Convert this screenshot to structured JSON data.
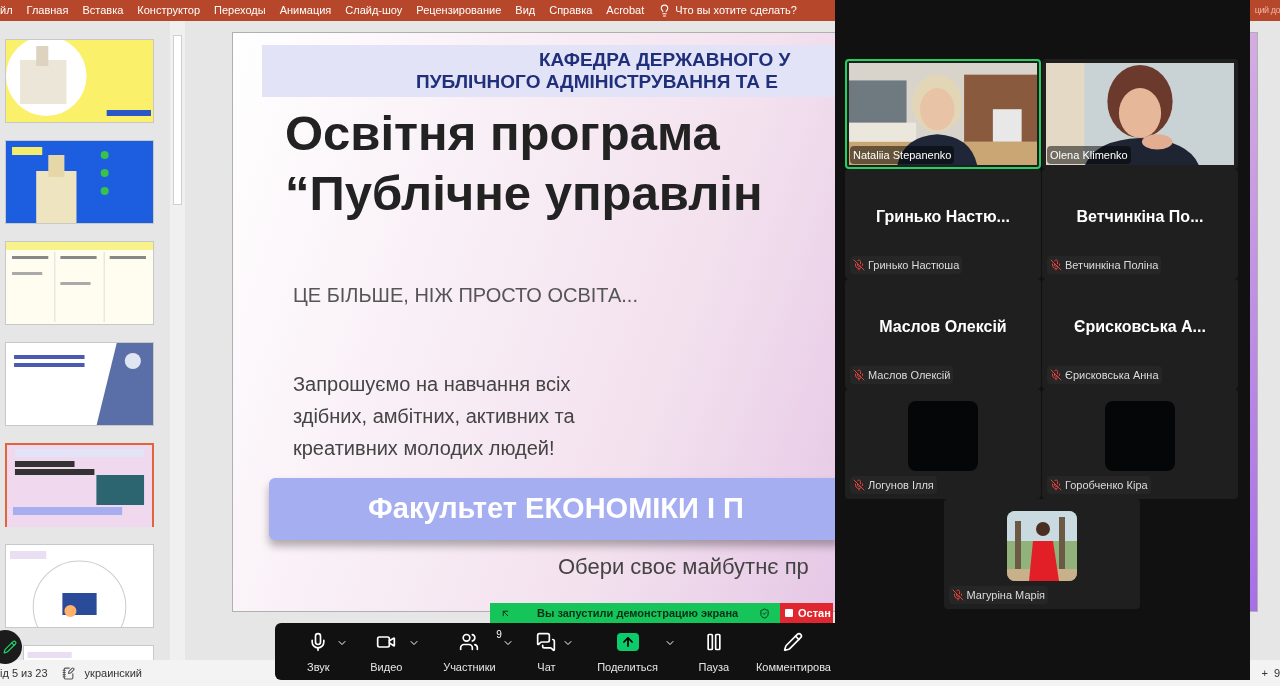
{
  "ribbon": {
    "tabs": [
      "йл",
      "Главная",
      "Вставка",
      "Конструктор",
      "Переходы",
      "Анимация",
      "Слайд-шоу",
      "Рецензирование",
      "Вид",
      "Справка",
      "Acrobat"
    ],
    "search": "Что вы хотите сделать?",
    "cut_right": "ций до"
  },
  "slide_thumbnails": [
    {
      "kind": "campus",
      "selected": false
    },
    {
      "kind": "tower",
      "selected": false
    },
    {
      "kind": "table",
      "selected": false
    },
    {
      "kind": "title",
      "selected": false
    },
    {
      "kind": "current",
      "selected": true
    },
    {
      "kind": "diagram",
      "selected": false
    },
    {
      "kind": "partial",
      "selected": false
    }
  ],
  "slide": {
    "header": [
      "КАФЕДРА ДЕРЖАВНОГО У",
      "ПУБЛІЧНОГО АДМІНІСТРУВАННЯ ТА Е"
    ],
    "title": [
      "Освітня програма",
      "“Публічне управлін"
    ],
    "subtitle": "ЦЕ БІЛЬШЕ, НІЖ ПРОСТО ОСВІТА...",
    "invite": [
      "Запрошуємо на навчання  всіх",
      "здібних, амбітних, активних та",
      "креативних молодих людей!"
    ],
    "faculty": "Факультет ЕКОНОМІКИ І П",
    "slogan": "Обери своє майбутнє пр"
  },
  "share_banner": {
    "message": "Вы запустили демонстрацию экрана",
    "stop": "Остан"
  },
  "toolbar": [
    {
      "label": "Звук",
      "kind": "mic",
      "menu": true,
      "highlighted": false
    },
    {
      "label": "Видео",
      "kind": "camera",
      "menu": true,
      "highlighted": false
    },
    {
      "label": "Участники",
      "kind": "people",
      "menu": true,
      "badge": "9",
      "highlighted": false
    },
    {
      "label": "Чат",
      "kind": "chat",
      "menu": true,
      "highlighted": false
    },
    {
      "label": "Поделиться",
      "kind": "share",
      "menu": true,
      "highlighted": true
    },
    {
      "label": "Пауза",
      "kind": "pause",
      "menu": false,
      "highlighted": false
    },
    {
      "label": "Комментирова",
      "kind": "pen",
      "menu": false,
      "highlighted": false
    }
  ],
  "participants": [
    {
      "kind": "video",
      "label": "Nataliia Stepanenko",
      "muted": false,
      "speaking": true
    },
    {
      "kind": "video",
      "label": "Olena Klimenko",
      "muted": false,
      "speaking": false
    },
    {
      "kind": "name",
      "display": "Гринько Настю...",
      "label": "Гринько Настюша",
      "muted": true,
      "speaking": false
    },
    {
      "kind": "name",
      "display": "Ветчинкіна По...",
      "label": "Ветчинкіна Поліна",
      "muted": true,
      "speaking": false
    },
    {
      "kind": "name",
      "display": "Маслов Олексій",
      "label": "Маслов Олексій",
      "muted": true,
      "speaking": false
    },
    {
      "kind": "name",
      "display": "Єрисковська А...",
      "label": "Єрисковська Анна",
      "muted": true,
      "speaking": false
    },
    {
      "kind": "avatar",
      "label": "Логунов Ілля",
      "muted": true,
      "speaking": false
    },
    {
      "kind": "avatar",
      "label": "Горобченко Кіра",
      "muted": true,
      "speaking": false
    },
    {
      "label": "Магуріна Марія",
      "muted": true,
      "speaking": false
    }
  ],
  "status_bar": {
    "slide": "ід 5 из 23",
    "language": "украинский",
    "zoom_in": "+",
    "zoom": "9"
  }
}
